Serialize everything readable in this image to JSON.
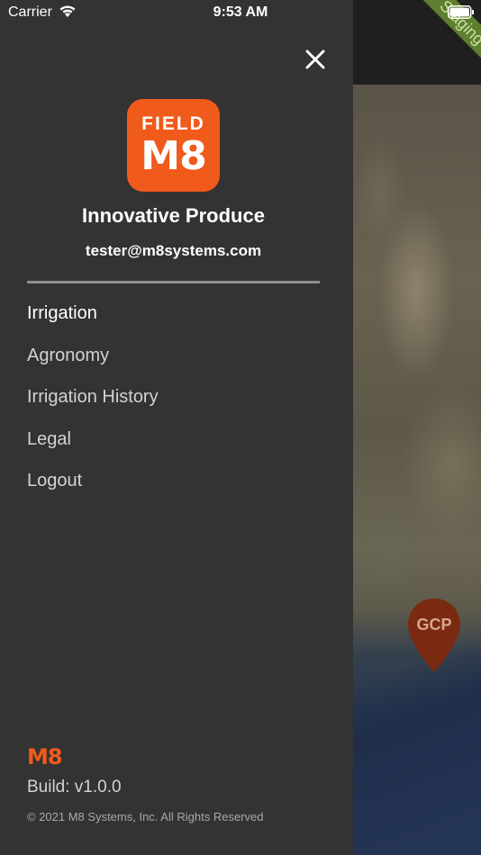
{
  "status_bar": {
    "carrier": "Carrier",
    "time": "9:53 AM"
  },
  "environment_banner": "Staging",
  "map": {
    "marker_label": "GCP",
    "marker_color": "#7a2a10"
  },
  "drawer": {
    "close_icon": "close-icon",
    "logo": {
      "line1": "FIELD",
      "line2": "M8",
      "color": "#f05a1a"
    },
    "company_name": "Innovative Produce",
    "user_email": "tester@m8systems.com",
    "menu": [
      {
        "label": "Irrigation",
        "active": true
      },
      {
        "label": "Agronomy",
        "active": false
      },
      {
        "label": "Irrigation History",
        "active": false
      },
      {
        "label": "Legal",
        "active": false
      },
      {
        "label": "Logout",
        "active": false
      }
    ],
    "footer": {
      "brand_mark": "M8",
      "build": "Build: v1.0.0",
      "copyright": "© 2021 M8 Systems, Inc. All Rights Reserved"
    }
  }
}
